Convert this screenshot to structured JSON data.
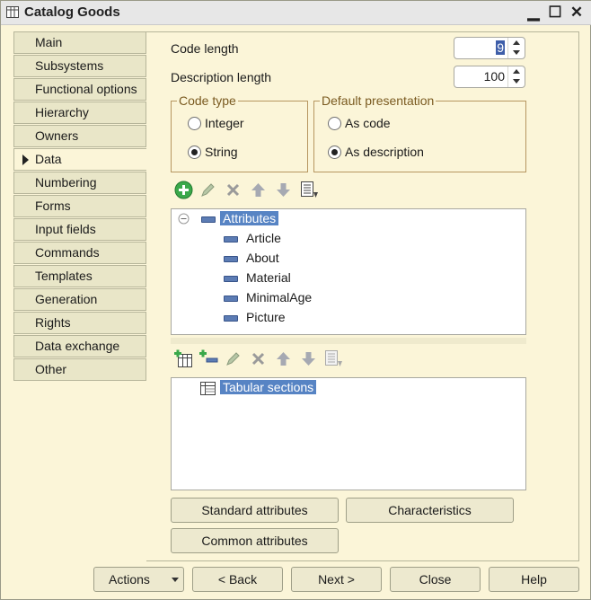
{
  "window": {
    "title": "Catalog Goods",
    "title_icon": "table-icon",
    "controls": {
      "minimize": "▁",
      "maximize": "☐",
      "close": "✕"
    }
  },
  "sidebar": {
    "items": [
      {
        "label": "Main"
      },
      {
        "label": "Subsystems"
      },
      {
        "label": "Functional options"
      },
      {
        "label": "Hierarchy"
      },
      {
        "label": "Owners"
      },
      {
        "label": "Data",
        "active": true
      },
      {
        "label": "Numbering"
      },
      {
        "label": "Forms"
      },
      {
        "label": "Input fields"
      },
      {
        "label": "Commands"
      },
      {
        "label": "Templates"
      },
      {
        "label": "Generation"
      },
      {
        "label": "Rights"
      },
      {
        "label": "Data exchange"
      },
      {
        "label": "Other"
      }
    ]
  },
  "form": {
    "code_length_label": "Code length",
    "code_length_value": "9",
    "description_length_label": "Description length",
    "description_length_value": "100",
    "code_type": {
      "legend": "Code type",
      "options": [
        "Integer",
        "String"
      ],
      "selected": "String"
    },
    "default_presentation": {
      "legend": "Default presentation",
      "options": [
        "As code",
        "As description"
      ],
      "selected": "As description"
    }
  },
  "attributes_tree": {
    "root": "Attributes",
    "children": [
      "Article",
      "About",
      "Material",
      "MinimalAge",
      "Picture"
    ]
  },
  "tabular_tree": {
    "root": "Tabular sections"
  },
  "buttons": {
    "standard_attributes": "Standard attributes",
    "characteristics": "Characteristics",
    "common_attributes": "Common attributes"
  },
  "footer": {
    "actions": "Actions",
    "back": "< Back",
    "next": "Next >",
    "close": "Close",
    "help": "Help"
  },
  "colors": {
    "window_bg": "#fbf5d8",
    "selection": "#5784c4",
    "legend_text": "#7a5a20"
  }
}
